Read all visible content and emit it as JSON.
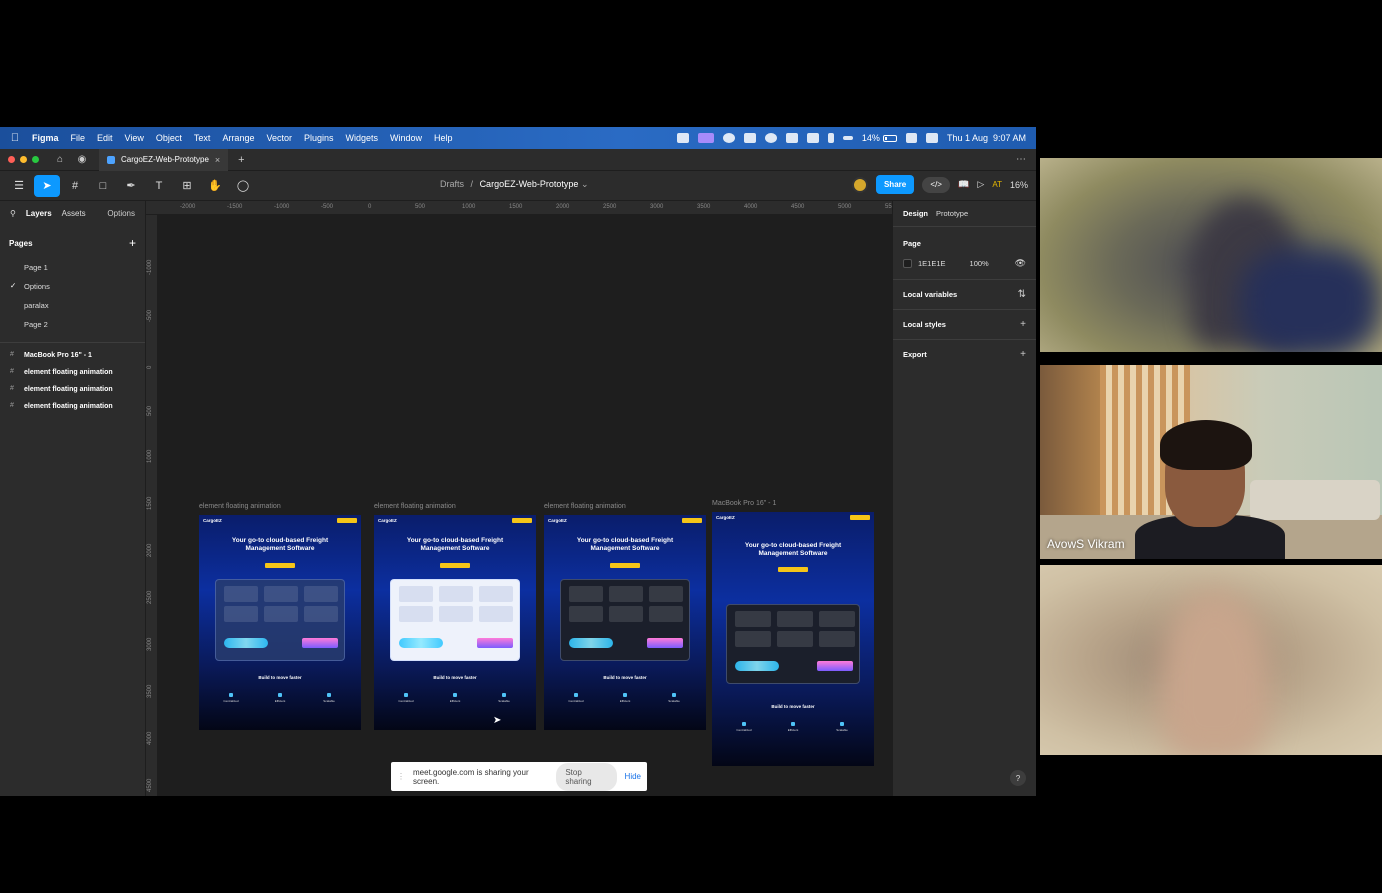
{
  "menubar": {
    "app": "Figma",
    "items": [
      "File",
      "Edit",
      "View",
      "Object",
      "Text",
      "Arrange",
      "Vector",
      "Plugins",
      "Widgets",
      "Window",
      "Help"
    ],
    "battery": "14%",
    "datetime": "Thu 1 Aug  9:07 AM"
  },
  "tabbar": {
    "tab_title": "CargoEZ-Web-Prototype"
  },
  "toolbar": {
    "breadcrumb_root": "Drafts",
    "breadcrumb_sep": "/",
    "file_name": "CargoEZ-Web-Prototype",
    "share_label": "Share",
    "dev_label": "</>",
    "at_label": "AT",
    "zoom": "16%"
  },
  "left_panel": {
    "tab_layers": "Layers",
    "tab_assets": "Assets",
    "options": "Options",
    "pages_header": "Pages",
    "pages": [
      "Page 1",
      "Options",
      "paralax",
      "Page 2"
    ],
    "current_page": "Options",
    "layers": [
      "MacBook Pro 16\" - 1",
      "element floating animation",
      "element floating animation",
      "element floating animation"
    ]
  },
  "rulers": {
    "h_ticks": [
      "-2000",
      "-1500",
      "-1000",
      "-500",
      "0",
      "500",
      "1000",
      "1500",
      "2000",
      "2500",
      "3000",
      "3500",
      "4000",
      "4500",
      "5000",
      "55"
    ],
    "v_ticks": [
      "-1000",
      "-500",
      "0",
      "500",
      "1000",
      "1500",
      "2000",
      "2500",
      "3000",
      "3500",
      "4000",
      "4500",
      "5000",
      "5500",
      "6000"
    ]
  },
  "canvas": {
    "frames": [
      {
        "label": "element floating animation",
        "logo": "CargoEZ",
        "hero": "Your go-to cloud-based Freight Management Software",
        "subtitle": "Build to move faster",
        "features": [
          "Centralized",
          "Efficient",
          "Scalable"
        ],
        "style": "glass"
      },
      {
        "label": "element floating animation",
        "logo": "CargoEZ",
        "hero": "Your go-to cloud-based Freight Management Software",
        "subtitle": "Build to move faster",
        "features": [
          "Centralized",
          "Efficient",
          "Scalable"
        ],
        "style": "white"
      },
      {
        "label": "element floating animation",
        "logo": "CargoEZ",
        "hero": "Your go-to cloud-based Freight Management Software",
        "subtitle": "Build to move faster",
        "features": [
          "Centralized",
          "Efficient",
          "Scalable"
        ],
        "style": "dark"
      },
      {
        "label": "MacBook Pro 16\" - 1",
        "logo": "CargoEZ",
        "hero": "Your go-to cloud-based Freight Management Software",
        "subtitle": "Build to move faster",
        "features": [
          "Centralized",
          "Efficient",
          "Scalable"
        ],
        "style": "dark"
      }
    ]
  },
  "right_panel": {
    "tab_design": "Design",
    "tab_prototype": "Prototype",
    "page_header": "Page",
    "bg_color": "1E1E1E",
    "bg_opacity": "100%",
    "local_variables": "Local variables",
    "local_styles": "Local styles",
    "export": "Export",
    "help": "?"
  },
  "share_banner": {
    "message": "meet.google.com is sharing your screen.",
    "stop_label": "Stop sharing",
    "hide_label": "Hide"
  },
  "participants": {
    "named": "AvowS Vikram"
  },
  "colors": {
    "figma_blue": "#0d99ff",
    "canvas_bg": "#1e1e1e",
    "panel_bg": "#2c2c2c",
    "cta_yellow": "#f5c518"
  }
}
